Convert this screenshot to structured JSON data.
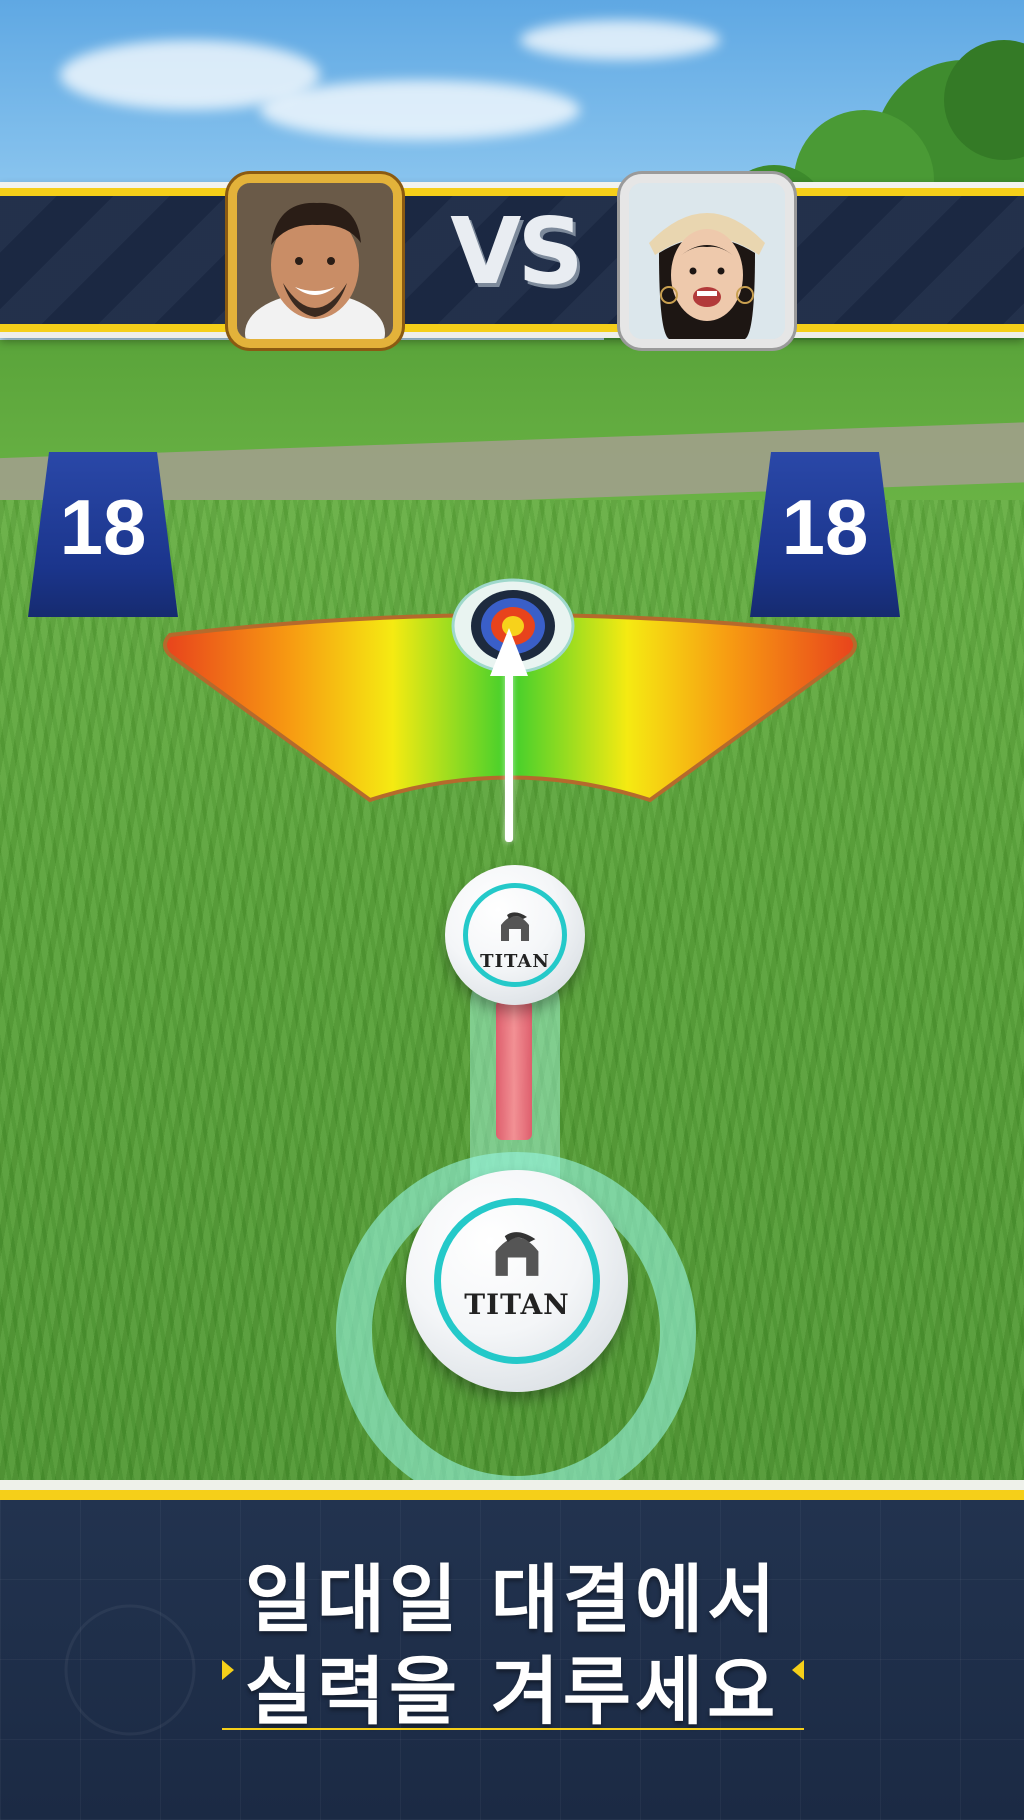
{
  "match": {
    "vs_label": "VS",
    "player_one_avatar": "avatar-man-smiling",
    "player_two_avatar": "avatar-woman-smiling"
  },
  "hole": {
    "left_marker_number": "18",
    "right_marker_number": "18"
  },
  "ball": {
    "brand_small": "TITAN",
    "brand_large": "TITAN"
  },
  "promo": {
    "line1": "일대일 대결에서",
    "line2": "실력을 겨루세요"
  },
  "colors": {
    "banner_navy": "#1c2a45",
    "banner_yellow": "#f5cf19",
    "ball_stripe": "#24c9c9",
    "tee_blue": "#1b358c"
  }
}
